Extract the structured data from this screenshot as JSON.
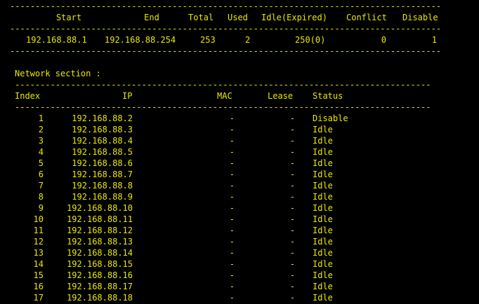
{
  "colors": {
    "background": "#000000",
    "text": "#e8e800"
  },
  "dash_line": "--------------------------------------------------------------------------------------------------",
  "dash_line_short": "-------------------------------------------------------------------------------------------",
  "summary": {
    "headers": {
      "start": "Start",
      "end": "End",
      "total": "Total",
      "used": "Used",
      "idle": "Idle(Expired)",
      "conflict": "Conflict",
      "disable": "Disable"
    },
    "row": {
      "start": "192.168.88.1",
      "end": "192.168.88.254",
      "total": "253",
      "used": "2",
      "idle": "250(0)",
      "conflict": "0",
      "disable": "1"
    }
  },
  "section_title": "Network section :",
  "table": {
    "headers": {
      "index": "Index",
      "ip": "IP",
      "mac": "MAC",
      "lease": "Lease",
      "status": "Status"
    },
    "rows": [
      {
        "index": "1",
        "ip": "192.168.88.2",
        "mac": "-",
        "lease": "-",
        "status": "Disable"
      },
      {
        "index": "2",
        "ip": "192.168.88.3",
        "mac": "-",
        "lease": "-",
        "status": "Idle"
      },
      {
        "index": "3",
        "ip": "192.168.88.4",
        "mac": "-",
        "lease": "-",
        "status": "Idle"
      },
      {
        "index": "4",
        "ip": "192.168.88.5",
        "mac": "-",
        "lease": "-",
        "status": "Idle"
      },
      {
        "index": "5",
        "ip": "192.168.88.6",
        "mac": "-",
        "lease": "-",
        "status": "Idle"
      },
      {
        "index": "6",
        "ip": "192.168.88.7",
        "mac": "-",
        "lease": "-",
        "status": "Idle"
      },
      {
        "index": "7",
        "ip": "192.168.88.8",
        "mac": "-",
        "lease": "-",
        "status": "Idle"
      },
      {
        "index": "8",
        "ip": "192.168.88.9",
        "mac": "-",
        "lease": "-",
        "status": "Idle"
      },
      {
        "index": "9",
        "ip": "192.168.88.10",
        "mac": "-",
        "lease": "-",
        "status": "Idle"
      },
      {
        "index": "10",
        "ip": "192.168.88.11",
        "mac": "-",
        "lease": "-",
        "status": "Idle"
      },
      {
        "index": "11",
        "ip": "192.168.88.12",
        "mac": "-",
        "lease": "-",
        "status": "Idle"
      },
      {
        "index": "12",
        "ip": "192.168.88.13",
        "mac": "-",
        "lease": "-",
        "status": "Idle"
      },
      {
        "index": "13",
        "ip": "192.168.88.14",
        "mac": "-",
        "lease": "-",
        "status": "Idle"
      },
      {
        "index": "14",
        "ip": "192.168.88.15",
        "mac": "-",
        "lease": "-",
        "status": "Idle"
      },
      {
        "index": "15",
        "ip": "192.168.88.16",
        "mac": "-",
        "lease": "-",
        "status": "Idle"
      },
      {
        "index": "16",
        "ip": "192.168.88.17",
        "mac": "-",
        "lease": "-",
        "status": "Idle"
      },
      {
        "index": "17",
        "ip": "192.168.88.18",
        "mac": "-",
        "lease": "-",
        "status": "Idle"
      }
    ]
  }
}
